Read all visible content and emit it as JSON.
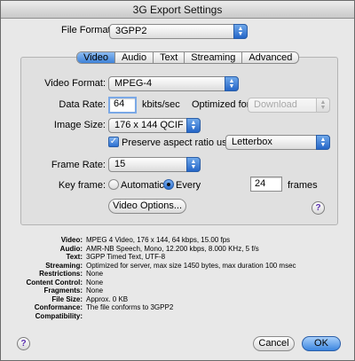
{
  "window": {
    "title": "3G Export Settings"
  },
  "file_format": {
    "label": "File Format:",
    "value": "3GPP2"
  },
  "tabs": [
    {
      "label": "Video",
      "active": true
    },
    {
      "label": "Audio",
      "active": false
    },
    {
      "label": "Text",
      "active": false
    },
    {
      "label": "Streaming",
      "active": false
    },
    {
      "label": "Advanced",
      "active": false
    }
  ],
  "video": {
    "format_label": "Video Format:",
    "format_value": "MPEG-4",
    "data_rate_label": "Data Rate:",
    "data_rate_value": "64",
    "data_rate_unit": "kbits/sec",
    "optimized_label": "Optimized for:",
    "optimized_value": "Download",
    "image_size_label": "Image Size:",
    "image_size_value": "176 x 144 QCIF",
    "preserve_label": "Preserve aspect ratio using:",
    "preserve_checked": true,
    "preserve_mode": "Letterbox",
    "frame_rate_label": "Frame Rate:",
    "frame_rate_value": "15",
    "keyframe_label": "Key frame:",
    "keyframe_automatic": "Automatic",
    "keyframe_every": "Every",
    "keyframe_selected": "every",
    "keyframe_value": "24",
    "keyframe_unit": "frames",
    "options_button": "Video Options..."
  },
  "summary": [
    {
      "key": "Video:",
      "value": "MPEG 4 Video, 176 x 144, 64 kbps, 15.00 fps"
    },
    {
      "key": "Audio:",
      "value": "AMR-NB Speech, Mono, 12.200 kbps, 8.000 KHz, 5 f/s"
    },
    {
      "key": "Text:",
      "value": "3GPP Timed Text, UTF-8"
    },
    {
      "key": "Streaming:",
      "value": "Optimized for server, max size 1450 bytes, max duration 100 msec"
    },
    {
      "key": "Restrictions:",
      "value": "None"
    },
    {
      "key": "Content Control:",
      "value": "None"
    },
    {
      "key": "Fragments:",
      "value": "None"
    },
    {
      "key": "File Size:",
      "value": "Approx. 0 KB"
    },
    {
      "key": "Conformance:",
      "value": "The file conforms to 3GPP2"
    },
    {
      "key": "Compatibility:",
      "value": ""
    }
  ],
  "buttons": {
    "cancel": "Cancel",
    "ok": "OK",
    "help": "?"
  },
  "colors": {
    "accent": "#3f83d8",
    "window_bg": "#e8e8e8"
  }
}
